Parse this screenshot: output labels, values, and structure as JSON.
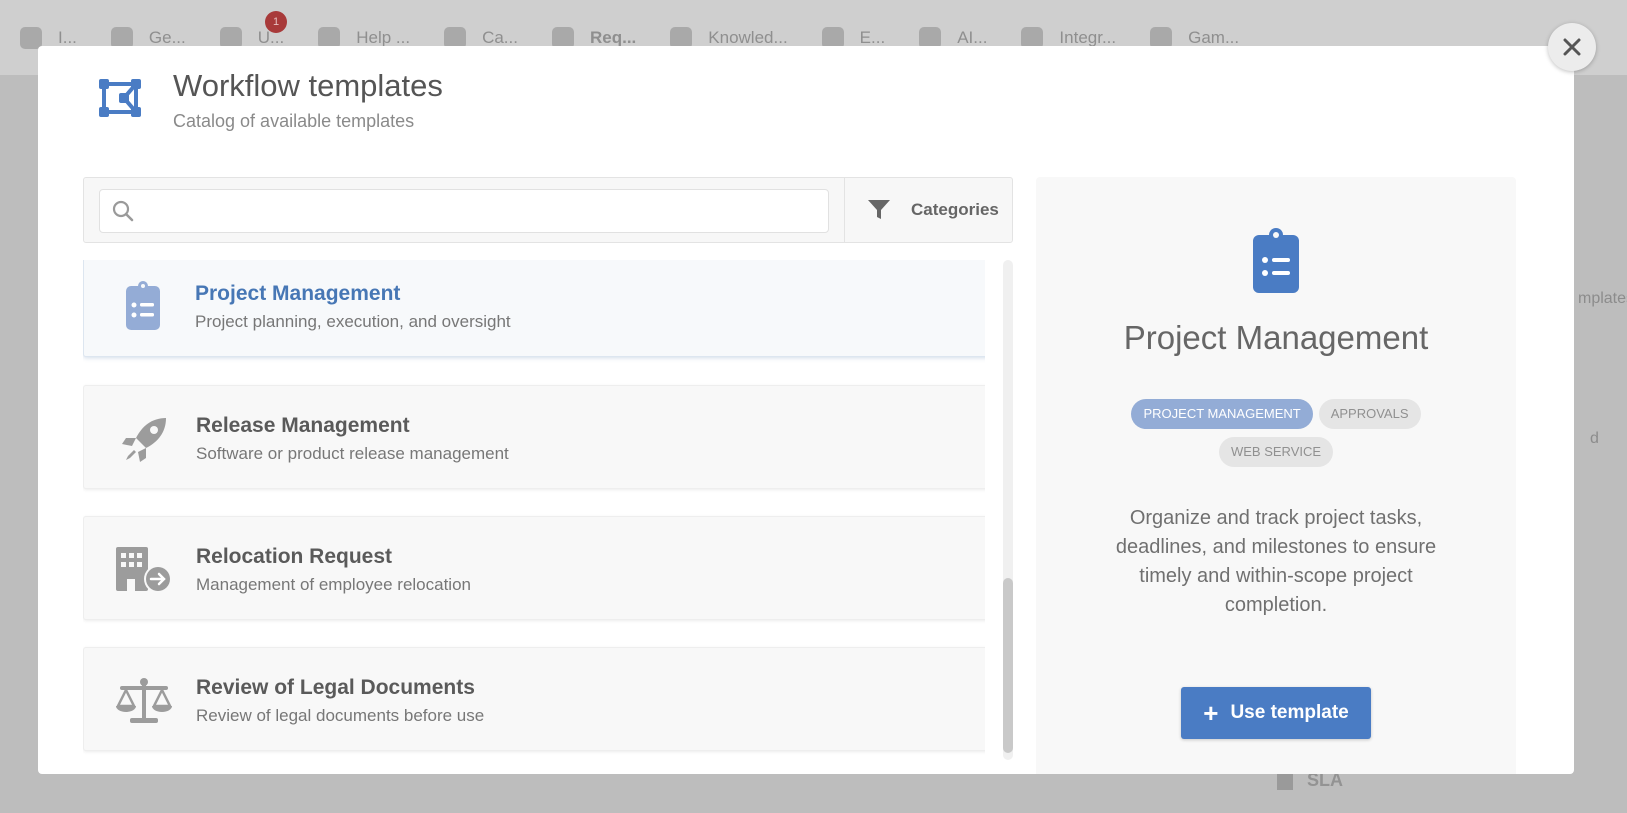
{
  "background": {
    "tabs": [
      {
        "label": "I...",
        "bold": false
      },
      {
        "label": "Ge...",
        "bold": false
      },
      {
        "label": "U...",
        "bold": false
      },
      {
        "label": "Help ...",
        "bold": false
      },
      {
        "label": "Ca...",
        "bold": false
      },
      {
        "label": "Req...",
        "bold": true
      },
      {
        "label": "Knowled...",
        "bold": false
      },
      {
        "label": "E...",
        "bold": false
      },
      {
        "label": "AI...",
        "bold": false
      },
      {
        "label": "Integr...",
        "bold": false
      },
      {
        "label": "Gam...",
        "bold": false
      }
    ],
    "badge_count": "1",
    "side_text_1": "mplates",
    "side_text_2": "d",
    "sla_label": "SLA"
  },
  "modal": {
    "title": "Workflow templates",
    "subtitle": "Catalog of available templates",
    "search": {
      "placeholder": "",
      "value": ""
    },
    "categories_label": "Categories",
    "templates": [
      {
        "name": "Project Management",
        "description": "Project planning, execution, and oversight",
        "icon": "clipboard-list-icon",
        "selected": true
      },
      {
        "name": "Release Management",
        "description": "Software or product release management",
        "icon": "rocket-icon",
        "selected": false
      },
      {
        "name": "Relocation Request",
        "description": "Management of employee relocation",
        "icon": "building-arrow-icon",
        "selected": false
      },
      {
        "name": "Review of Legal Documents",
        "description": "Review of legal documents before use",
        "icon": "scales-icon",
        "selected": false
      }
    ],
    "detail": {
      "title": "Project Management",
      "tags": [
        "PROJECT MANAGEMENT",
        "APPROVALS",
        "WEB SERVICE"
      ],
      "description": "Organize and track project tasks, deadlines, and milestones to ensure timely and within-scope project completion.",
      "use_button_label": "Use template"
    }
  },
  "colors": {
    "accent": "#4a7cc4",
    "selected_title": "#4777b5",
    "tag_primary": "#93acd6"
  }
}
